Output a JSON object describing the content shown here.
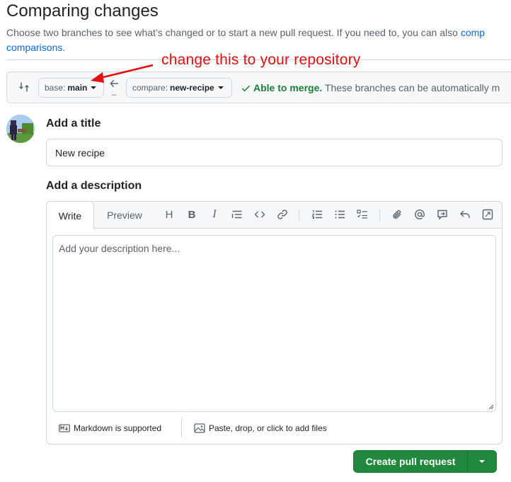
{
  "header": {
    "title": "Comparing changes",
    "subtitle_line1": "Choose two branches to see what’s changed or to start a new pull request. If you need to, you can also ",
    "subtitle_link1": "comp",
    "subtitle_link2": "comparisons",
    "subtitle_end": "."
  },
  "annotation": {
    "text": "change this to your repository",
    "color": "#e01010"
  },
  "range": {
    "icon": "git-compare-icon",
    "base_label": "base:",
    "base_value": "main",
    "swap_icon": "arrow-left-icon",
    "swap_dots": "...",
    "compare_label": "compare:",
    "compare_value": "new-recipe",
    "status_icon": "check-icon",
    "status_ok": "Able to merge.",
    "status_rest": " These branches can be automatically m"
  },
  "form": {
    "title_label": "Add a title",
    "title_value": "New recipe",
    "description_label": "Add a description",
    "description_placeholder": "Add your description here...",
    "tabs": [
      "Write",
      "Preview"
    ],
    "toolbar_icons": [
      "heading-icon",
      "bold-icon",
      "italic-icon",
      "quote-icon",
      "code-icon",
      "link-icon",
      "ordered-list-icon",
      "unordered-list-icon",
      "task-list-icon",
      "attach-icon",
      "mention-icon",
      "reference-icon",
      "reply-icon",
      "fullscreen-icon"
    ],
    "toolbar_heading_glyph": "H",
    "toolbar_bold_glyph": "B",
    "toolbar_italic_glyph": "I",
    "markdown_note": "Markdown is supported",
    "files_note": "Paste, drop, or click to add files"
  },
  "actions": {
    "create_label": "Create pull request",
    "accent": "#1f883d"
  },
  "colors": {
    "link": "#0969da",
    "success": "#1a7f37",
    "muted": "#59636e",
    "border": "#d1d9e0"
  }
}
